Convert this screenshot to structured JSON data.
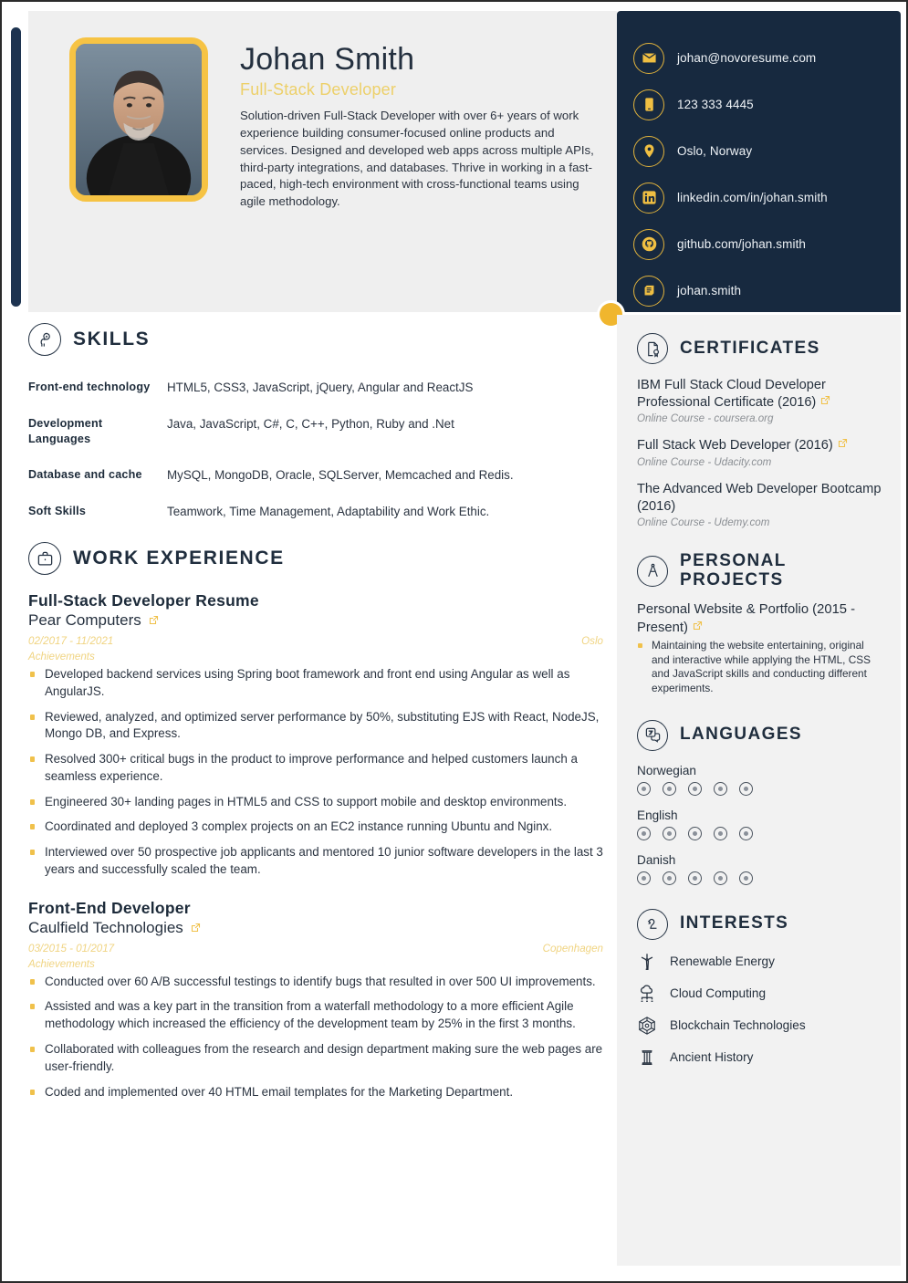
{
  "header": {
    "name": "Johan Smith",
    "job_title": "Full-Stack Developer",
    "summary": "Solution-driven Full-Stack Developer with over 6+ years of work experience building consumer-focused online products and services. Designed and developed web apps across multiple APIs, third-party integrations, and databases. Thrive in working in a fast-paced, high-tech environment with cross-functional teams using agile methodology.",
    "photo_alt": "profile-photo"
  },
  "colors": {
    "navy": "#17293f",
    "gold": "#f0b62e",
    "gold_light": "#f0d482",
    "panel_gray": "#f2f2f2",
    "header_gray": "#efefef"
  },
  "contacts": [
    {
      "icon": "email-icon",
      "value": "johan@novoresume.com"
    },
    {
      "icon": "phone-icon",
      "value": "123 333 4445"
    },
    {
      "icon": "location-icon",
      "value": "Oslo, Norway"
    },
    {
      "icon": "linkedin-icon",
      "value": "linkedin.com/in/johan.smith"
    },
    {
      "icon": "github-icon",
      "value": "github.com/johan.smith"
    },
    {
      "icon": "skype-icon",
      "value": "johan.smith"
    }
  ],
  "skills": {
    "section_title": "SKILLS",
    "section_icon": "lightbulb-head-icon",
    "rows": [
      {
        "label": "Front-end technology",
        "value": "HTML5, CSS3, JavaScript, jQuery, Angular and ReactJS"
      },
      {
        "label": "Development Languages",
        "value": "Java, JavaScript, C#, C, C++, Python, Ruby and .Net"
      },
      {
        "label": "Database and cache",
        "value": "MySQL, MongoDB, Oracle, SQLServer, Memcached and Redis."
      },
      {
        "label": "Soft Skills",
        "value": "Teamwork, Time Management, Adaptability and Work Ethic."
      }
    ]
  },
  "work_experience": {
    "section_title": "WORK EXPERIENCE",
    "section_icon": "briefcase-icon",
    "achievements_label": "Achievements",
    "jobs": [
      {
        "role": "Full-Stack Developer Resume",
        "company": "Pear Computers",
        "dates": "02/2017 - 11/2021",
        "location": "Oslo",
        "bullets": [
          "Developed backend services using Spring boot framework and front end using Angular as well as AngularJS.",
          "Reviewed, analyzed, and optimized server performance by 50%, substituting EJS with React, NodeJS, Mongo DB, and Express.",
          "Resolved 300+ critical bugs in the product to improve performance and helped customers launch a seamless experience.",
          "Engineered 30+ landing pages in HTML5 and CSS to support mobile and desktop environments.",
          "Coordinated and deployed 3 complex projects on an EC2 instance running Ubuntu and Nginx.",
          "Interviewed over 50 prospective job applicants and mentored 10 junior software developers in the last 3 years and successfully scaled the team."
        ]
      },
      {
        "role": "Front-End Developer",
        "company": "Caulfield Technologies",
        "dates": "03/2015 - 01/2017",
        "location": "Copenhagen",
        "bullets": [
          "Conducted over 60 A/B successful testings to identify bugs that resulted in over 500 UI improvements.",
          "Assisted and was a key part in the transition from a waterfall methodology to a more efficient Agile methodology which increased the efficiency of the development team by 25% in the first 3 months.",
          "Collaborated with colleagues from the research and design department making sure the web pages are user-friendly.",
          "Coded and implemented over 40 HTML email templates for the Marketing Department."
        ]
      }
    ]
  },
  "certificates": {
    "section_title": "CERTIFICATES",
    "section_icon": "certificate-icon",
    "items": [
      {
        "title": "IBM Full Stack Cloud Developer Professional Certificate (2016)",
        "subtitle": "Online Course - coursera.org"
      },
      {
        "title": "Full Stack Web Developer (2016)",
        "subtitle": "Online Course - Udacity.com"
      },
      {
        "title": "The Advanced Web Developer Bootcamp (2016)",
        "subtitle": "Online Course - Udemy.com"
      }
    ]
  },
  "personal_projects": {
    "section_title": "PERSONAL PROJECTS",
    "section_icon": "compass-icon",
    "items": [
      {
        "title": "Personal Website & Portfolio (2015 - Present)",
        "bullets": [
          "Maintaining the website entertaining, original and interactive while applying the HTML, CSS and JavaScript skills and conducting different experiments."
        ]
      }
    ]
  },
  "languages": {
    "section_title": "LANGUAGES",
    "section_icon": "translate-icon",
    "max_level": 5,
    "items": [
      {
        "name": "Norwegian",
        "level": 5
      },
      {
        "name": "English",
        "level": 5
      },
      {
        "name": "Danish",
        "level": 5
      }
    ]
  },
  "interests": {
    "section_title": "INTERESTS",
    "section_icon": "chess-knight-icon",
    "items": [
      {
        "icon": "wind-turbine-icon",
        "label": "Renewable Energy"
      },
      {
        "icon": "cloud-network-icon",
        "label": "Cloud Computing"
      },
      {
        "icon": "blockchain-icon",
        "label": "Blockchain Technologies"
      },
      {
        "icon": "column-icon",
        "label": "Ancient History"
      }
    ]
  }
}
